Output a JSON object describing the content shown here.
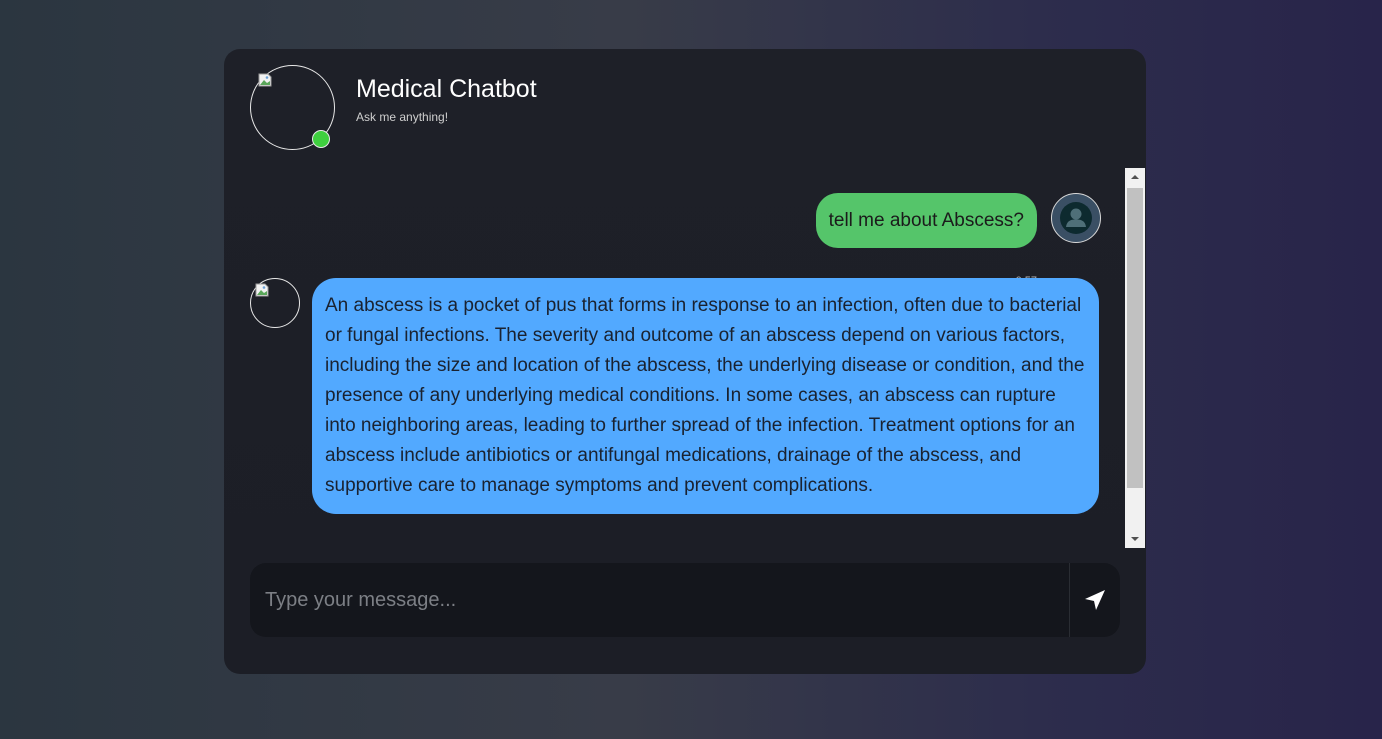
{
  "header": {
    "title": "Medical Chatbot",
    "subtitle": "Ask me anything!",
    "status_color": "#3fcf3f"
  },
  "messages": [
    {
      "sender": "user",
      "text": "tell me about Abscess?",
      "time": "0:57",
      "bubble_color": "#55c56a",
      "avatar_icon": "user-icon"
    },
    {
      "sender": "bot",
      "text": "An abscess is a pocket of pus that forms in response to an infection, often due to bacterial or fungal infections. The severity and outcome of an abscess depend on various factors, including the size and location of the abscess, the underlying disease or condition, and the presence of any underlying medical conditions. In some cases, an abscess can rupture into neighboring areas, leading to further spread of the infection. Treatment options for an abscess include antibiotics or antifungal medications, drainage of the abscess, and supportive care to manage symptoms and prevent complications.",
      "bubble_color": "#52a9ff",
      "avatar_icon": "broken-image-icon"
    }
  ],
  "composer": {
    "placeholder": "Type your message...",
    "send_icon": "send-icon"
  }
}
